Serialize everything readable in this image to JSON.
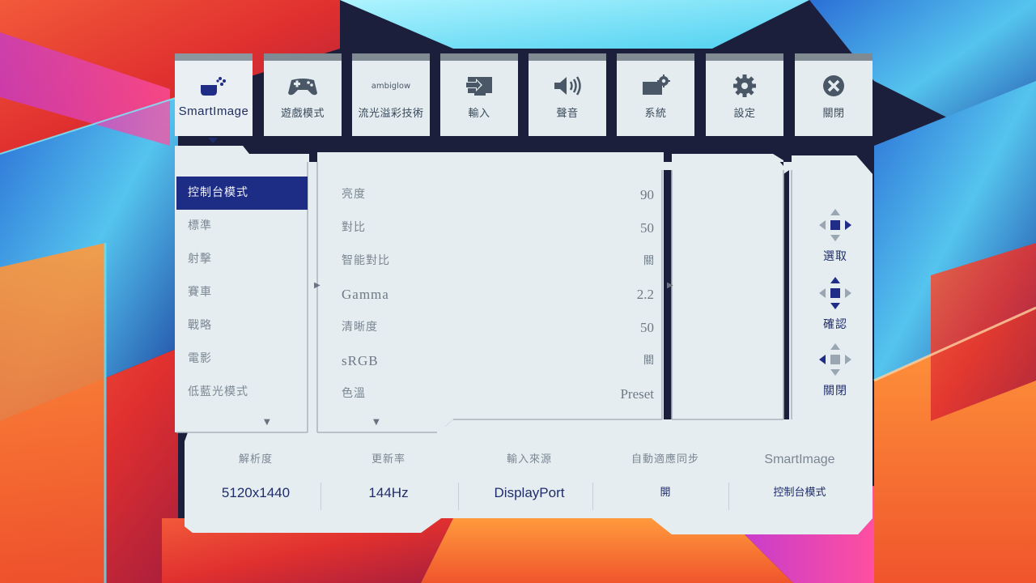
{
  "tabs": [
    {
      "label": "SmartImage",
      "icon": "smartimage-icon",
      "active": true
    },
    {
      "label": "遊戲模式",
      "icon": "gamepad-icon",
      "active": false
    },
    {
      "label": "流光溢彩技術",
      "icon": "ambiglow-icon",
      "active": false
    },
    {
      "label": "輸入",
      "icon": "input-icon",
      "active": false
    },
    {
      "label": "聲音",
      "icon": "speaker-icon",
      "active": false
    },
    {
      "label": "系統",
      "icon": "system-icon",
      "active": false
    },
    {
      "label": "設定",
      "icon": "gear-icon",
      "active": false
    },
    {
      "label": "關閉",
      "icon": "close-icon",
      "active": false
    }
  ],
  "ambiglow_logo_text": "ambiglow",
  "left_menu": {
    "items": [
      "控制台模式",
      "標準",
      "射擊",
      "賽車",
      "戰略",
      "電影",
      "低藍光模式"
    ],
    "selected": "控制台模式"
  },
  "settings": [
    {
      "label": "亮度",
      "value": "90"
    },
    {
      "label": "對比",
      "value": "50"
    },
    {
      "label": "智能對比",
      "value": "關"
    },
    {
      "label": "Gamma",
      "value": "2.2"
    },
    {
      "label": "清晰度",
      "value": "50"
    },
    {
      "label": "sRGB",
      "value": "關"
    },
    {
      "label": "色溫",
      "value": "Preset"
    }
  ],
  "nav": {
    "select": "選取",
    "confirm": "確認",
    "close": "關閉"
  },
  "info": [
    {
      "label": "解析度",
      "value": "5120x1440"
    },
    {
      "label": "更新率",
      "value": "144Hz"
    },
    {
      "label": "輸入來源",
      "value": "DisplayPort"
    },
    {
      "label": "自動適應同步",
      "value": "開"
    },
    {
      "label": "SmartImage",
      "value": "控制台模式"
    }
  ],
  "colors": {
    "panel": "#e5edf0",
    "accent": "#1d2d86",
    "text_dim": "#7a8692",
    "tab_bar": "#7f8a93"
  }
}
